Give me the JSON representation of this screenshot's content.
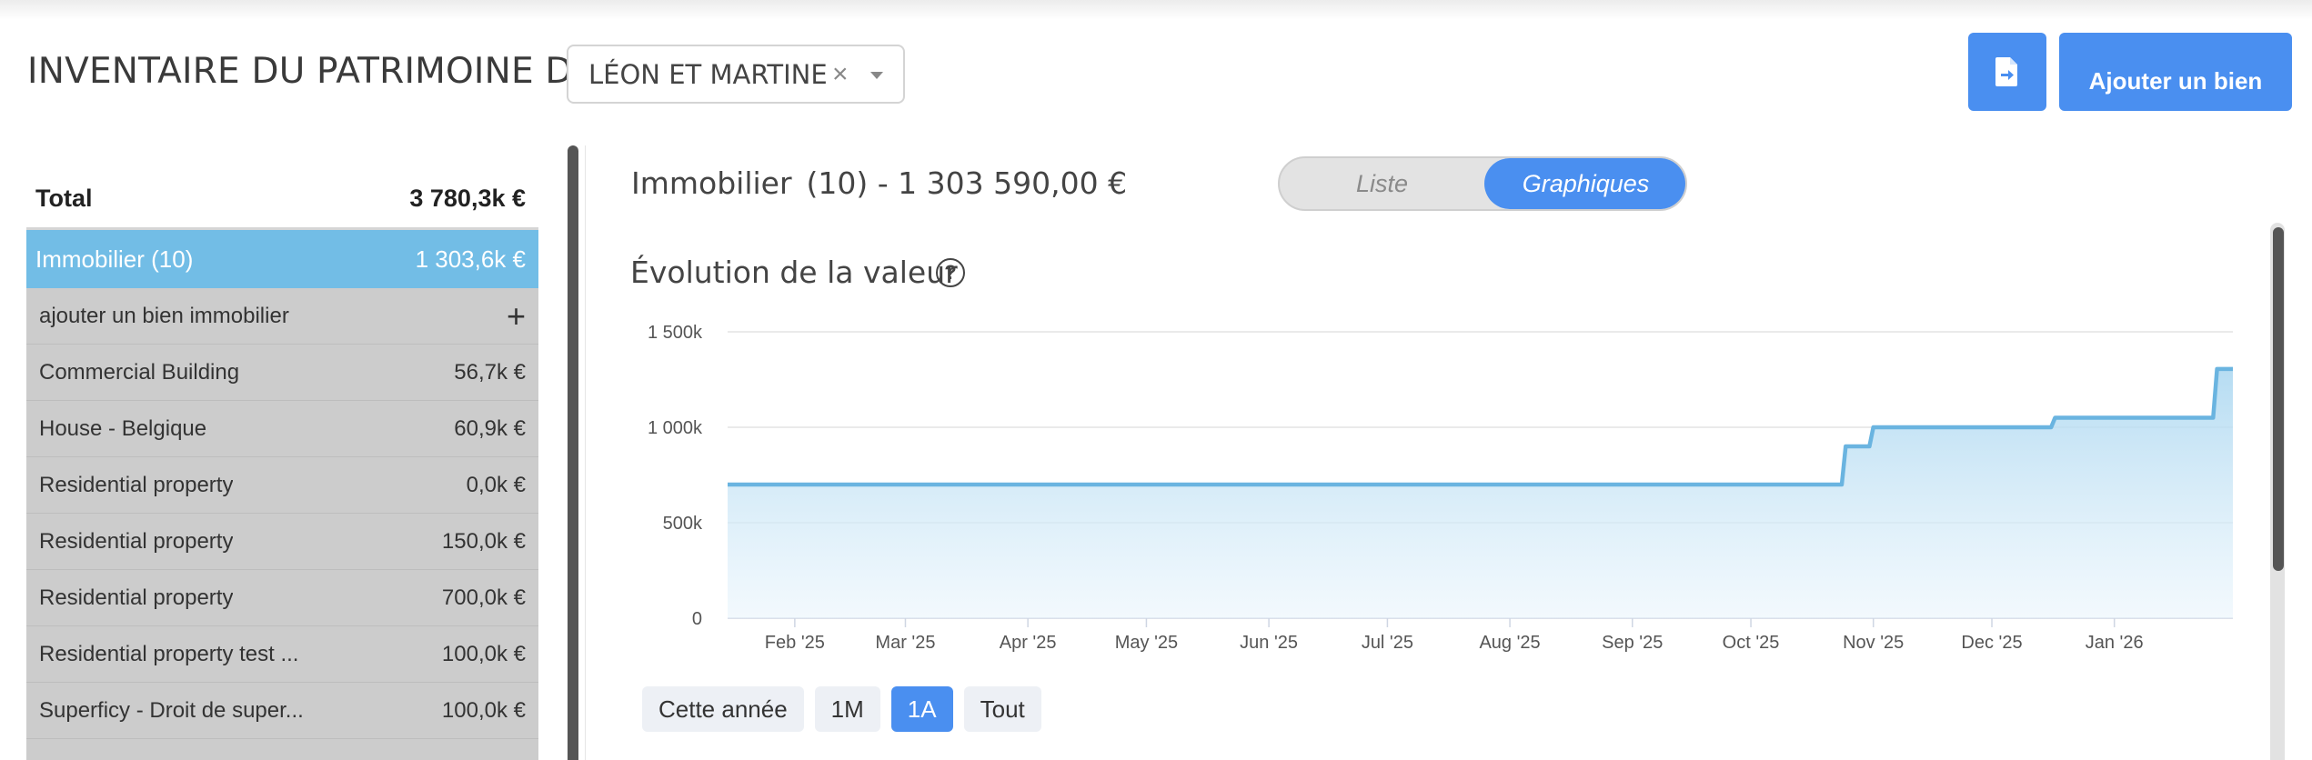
{
  "header": {
    "title": "INVENTAIRE DU PATRIMOINE DE",
    "client_value": "LÉON ET MARTINE",
    "clear_symbol": "×",
    "add_button_label": "Ajouter un bien"
  },
  "summary": {
    "total_label": "Total",
    "total_value": "3 780,3k €",
    "category_label": "Immobilier (10)",
    "category_value": "1 303,6k €",
    "add_row_label": "ajouter un bien immobilier",
    "add_row_symbol": "+",
    "items": [
      {
        "name": "Commercial Building",
        "value": "56,7k €"
      },
      {
        "name": "House - Belgique",
        "value": "60,9k €"
      },
      {
        "name": "Residential property",
        "value": "0,0k €"
      },
      {
        "name": "Residential property",
        "value": "150,0k €"
      },
      {
        "name": "Residential property",
        "value": "700,0k €"
      },
      {
        "name": "Residential property test ...",
        "value": "100,0k €"
      },
      {
        "name": "Superficy - Droit de super...",
        "value": "100,0k €"
      }
    ]
  },
  "main": {
    "section_label": "Immobilier",
    "section_count": "(10) - 1 303 590,00 €",
    "view_toggle": {
      "liste": "Liste",
      "graphiques": "Graphiques",
      "selected": "Graphiques"
    },
    "chart_title": "Évolution de la valeur",
    "help_symbol": "?",
    "range_buttons": [
      {
        "label": "Cette année",
        "active": false
      },
      {
        "label": "1M",
        "active": false
      },
      {
        "label": "1A",
        "active": true
      },
      {
        "label": "Tout",
        "active": false
      }
    ]
  },
  "colors": {
    "accent": "#4a8ff0",
    "category_row": "#72bde6",
    "item_row": "#cccccc",
    "series_line": "#6ab4e0"
  },
  "chart_data": {
    "type": "area",
    "title": "",
    "xlabel": "",
    "ylabel": "",
    "ylim": [
      0,
      1500
    ],
    "y_unit": "k",
    "y_ticks": [
      0,
      500,
      1000,
      1500
    ],
    "y_tick_labels": [
      "0",
      "500k",
      "1 000k",
      "1 500k"
    ],
    "x_tick_labels": [
      "Feb '25",
      "Mar '25",
      "Apr '25",
      "May '25",
      "Jun '25",
      "Jul '25",
      "Aug '25",
      "Sep '25",
      "Oct '25",
      "Nov '25",
      "Dec '25",
      "Jan '26"
    ],
    "x_tick_dates": [
      "2025-02-01",
      "2025-03-01",
      "2025-04-01",
      "2025-05-01",
      "2025-06-01",
      "2025-07-01",
      "2025-08-01",
      "2025-09-01",
      "2025-10-01",
      "2025-11-01",
      "2025-12-01",
      "2026-01-01"
    ],
    "x_range": [
      "2025-01-15",
      "2026-01-31"
    ],
    "grid": true,
    "legend": "none",
    "series": [
      {
        "points": [
          {
            "x": "2025-01-15",
            "y": 700
          },
          {
            "x": "2025-10-24",
            "y": 700
          },
          {
            "x": "2025-10-25",
            "y": 900
          },
          {
            "x": "2025-10-31",
            "y": 900
          },
          {
            "x": "2025-11-01",
            "y": 1000
          },
          {
            "x": "2025-12-16",
            "y": 1000
          },
          {
            "x": "2025-12-17",
            "y": 1050
          },
          {
            "x": "2026-01-26",
            "y": 1050
          },
          {
            "x": "2026-01-27",
            "y": 1305
          },
          {
            "x": "2026-01-31",
            "y": 1305
          }
        ]
      }
    ]
  }
}
